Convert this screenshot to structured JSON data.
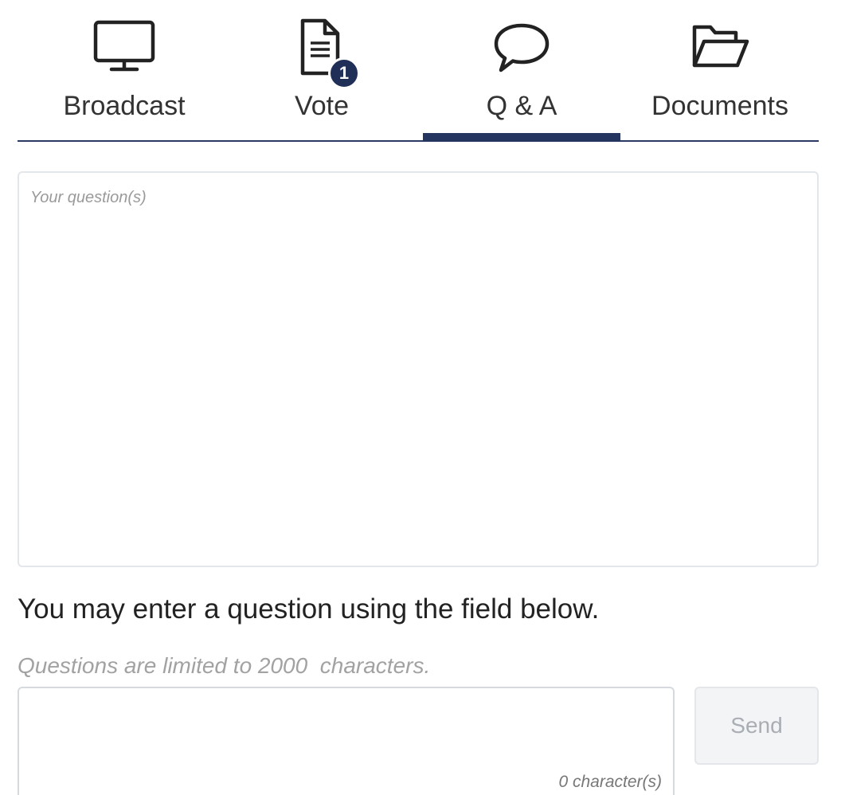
{
  "tabs": [
    {
      "label": "Broadcast",
      "icon": "monitor-icon",
      "active": false
    },
    {
      "label": "Vote",
      "icon": "document-icon",
      "active": false,
      "badge": "1"
    },
    {
      "label": "Q & A",
      "icon": "speech-bubble-icon",
      "active": true
    },
    {
      "label": "Documents",
      "icon": "folder-open-icon",
      "active": false
    }
  ],
  "colors": {
    "accent": "#24355f",
    "badge": "#1f2f57",
    "muted_text": "#a2a2a2",
    "button_bg": "#f3f4f6"
  },
  "history": {
    "placeholder": "Your question(s)"
  },
  "instruction": "You may enter a question using the field below.",
  "limit_note": "Questions are limited to 2000  characters.",
  "question_input": {
    "value": "",
    "placeholder": ""
  },
  "char_count": "0 character(s)",
  "send_label": "Send"
}
